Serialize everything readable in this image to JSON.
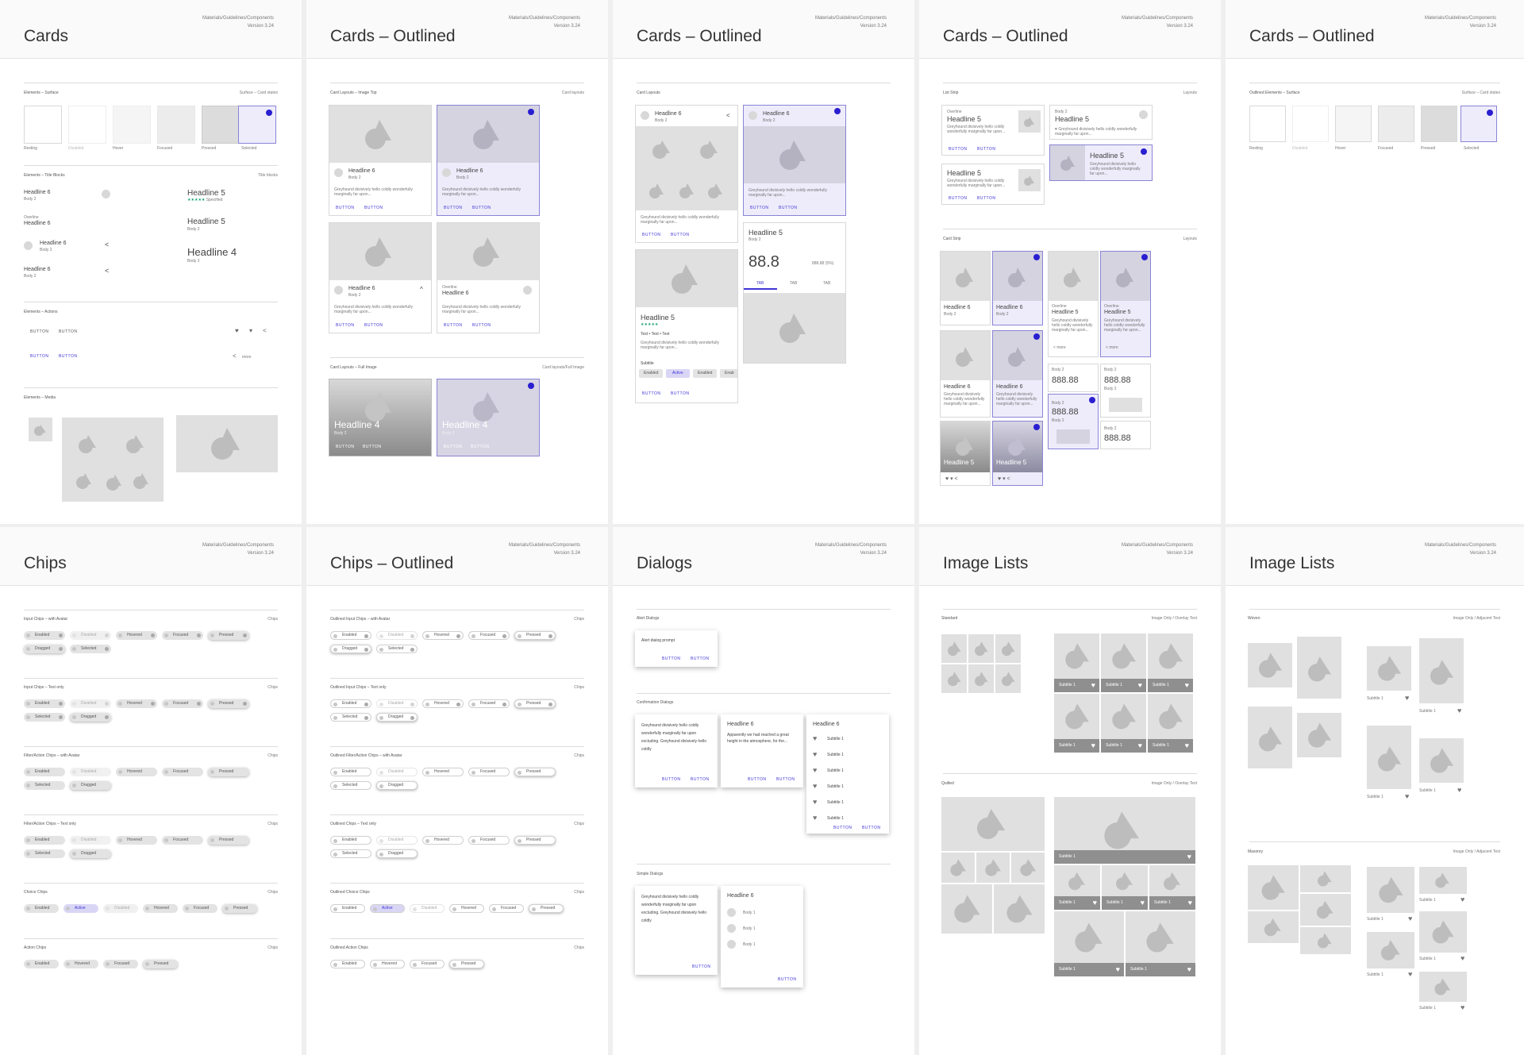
{
  "colors": {
    "accent": "#2a1fd0",
    "selected_bg": "#eeecfa"
  },
  "meta": {
    "path": "Materials/Guidelines/Components",
    "version": "Version 3.24"
  },
  "boards": {
    "cards": {
      "title": "Cards"
    },
    "cards_ol_1": {
      "title": "Cards – Outlined"
    },
    "cards_ol_2": {
      "title": "Cards – Outlined"
    },
    "cards_ol_3": {
      "title": "Cards – Outlined"
    },
    "cards_ol_4": {
      "title": "Cards – Outlined"
    },
    "chips": {
      "title": "Chips"
    },
    "chips_ol": {
      "title": "Chips – Outlined"
    },
    "dialogs": {
      "title": "Dialogs"
    },
    "image_lists_1": {
      "title": "Image Lists"
    },
    "image_lists_2": {
      "title": "Image Lists"
    }
  },
  "cards": {
    "surface_label": "Elements – Surface",
    "surface_link": "Surface – Card states",
    "states": [
      "Resting",
      "Disabled",
      "Hover",
      "Focused",
      "Pressed",
      "Selected"
    ],
    "title_blocks_label": "Elements – Title Blocks",
    "title_blocks_link": "Title blocks",
    "headline6": "Headline 6",
    "headline5": "Headline 5",
    "headline4": "Headline 4",
    "overline": "Overline",
    "body2": "Body 2",
    "rating_suffix": "Specified",
    "actions_label": "Elements – Actions",
    "button": "BUTTON",
    "more": "more",
    "media_label": "Elements – Media"
  },
  "cards_ol": {
    "image_top_label": "Card Layouts – Image Top",
    "image_top_link": "Card layouts",
    "full_image_label": "Card Layouts – Full Image",
    "full_image_link": "Card layouts/Full Image",
    "layouts_label": "Card Layouts",
    "card_text": "Greyhound divisively hello coldly wonderfully marginally far upon...",
    "chips_row": [
      "Enabled",
      "Active",
      "Enabled",
      "Enab"
    ],
    "tabs": [
      "TAB",
      "TAB",
      "TAB"
    ],
    "big_value": "88.8",
    "small_value": "888.88 (5%)",
    "subtitle": "Subtitle",
    "rating_meta": "Text • Text • Text",
    "list_label": "List Strip",
    "grid_label": "Card Strip",
    "stat_value": "888.88",
    "layouts_link": "Layouts",
    "surface_label": "Outlined Elements – Surface"
  },
  "chips": {
    "sections": [
      {
        "label": "Input Chips – with Avatar",
        "items": [
          "Enabled",
          "Disabled",
          "Hovered",
          "Focused",
          "Pressed",
          "Dragged",
          "Selected"
        ]
      },
      {
        "label": "Input Chips – Text only",
        "items": [
          "Enabled",
          "Disabled",
          "Hovered",
          "Focused",
          "Pressed",
          "Selected",
          "Dragged"
        ]
      },
      {
        "label": "Filter/Action Chips – with Avatar",
        "items": [
          "Enabled",
          "Disabled",
          "Hovered",
          "Focused",
          "Pressed",
          "Selected",
          "Dragged"
        ]
      },
      {
        "label": "Filter/Action Chips – Text only",
        "items": [
          "Enabled",
          "Disabled",
          "Hovered",
          "Focused",
          "Pressed",
          "Selected",
          "Dragged"
        ]
      },
      {
        "label": "Choice Chips",
        "items": [
          "Enabled",
          "Active",
          "Disabled",
          "Hovered",
          "Focused",
          "Pressed"
        ]
      },
      {
        "label": "Action Chips",
        "items": [
          "Enabled",
          "Hovered",
          "Focused",
          "Pressed"
        ]
      }
    ],
    "ol_sections": [
      {
        "label": "Outlined Input Chips – with Avatar",
        "items": [
          "Enabled",
          "Disabled",
          "Hovered",
          "Focused",
          "Pressed",
          "Dragged",
          "Selected"
        ]
      },
      {
        "label": "Outlined Input Chips – Text only",
        "items": [
          "Enabled",
          "Disabled",
          "Hovered",
          "Focused",
          "Pressed",
          "Selected",
          "Dragged"
        ]
      },
      {
        "label": "Outlined Filter/Action Chips – with Avatar",
        "items": [
          "Enabled",
          "Disabled",
          "Hovered",
          "Focused",
          "Pressed",
          "Selected",
          "Dragged"
        ]
      },
      {
        "label": "Outlined Chips – Text only",
        "items": [
          "Enabled",
          "Disabled",
          "Hovered",
          "Focused",
          "Pressed",
          "Selected",
          "Dragged"
        ]
      },
      {
        "label": "Outlined Choice Chips",
        "items": [
          "Enabled",
          "Active",
          "Disabled",
          "Hovered",
          "Focused",
          "Pressed"
        ]
      },
      {
        "label": "Outlined Action Chips",
        "items": [
          "Enabled",
          "Hovered",
          "Focused",
          "Pressed"
        ]
      }
    ],
    "link": "Chips"
  },
  "dialogs": {
    "alert_label": "Alert Dialogs",
    "alert_text": "Alert dialog prompt",
    "confirm_label": "Confirmation Dialogs",
    "confirm_text": "Greyhound divisively hello coldly wonderfully marginally far upon excluding. Greyhound divisively hello coldly",
    "confirm_text2": "Apparently we had reached a great height in the atmosphere, for the...",
    "simple_label": "Simple Dialogs",
    "headline6": "Headline 6",
    "subtitle1": "Subtitle 1",
    "body1": "Body 1",
    "button": "BUTTON"
  },
  "image_lists": {
    "standard_label": "Standard",
    "standard_link": "Image Only / Overlay Text",
    "quilted_label": "Quilted",
    "woven_label": "Woven",
    "woven_link": "Image Only / Adjacent Text",
    "masonry_label": "Masonry",
    "subtitle1": "Subtitle 1"
  }
}
